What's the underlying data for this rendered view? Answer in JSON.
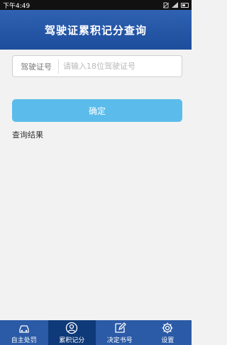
{
  "status_bar": {
    "time": "下午4:49"
  },
  "header": {
    "title": "驾驶证累积记分查询"
  },
  "form": {
    "license_label": "驾驶证号",
    "license_placeholder": "请输入18位驾驶证号",
    "license_value": "",
    "confirm_label": "确定"
  },
  "result": {
    "label": "查询结果"
  },
  "tabs": [
    {
      "label": "自主处罚",
      "icon": "car-icon",
      "active": false
    },
    {
      "label": "累积记分",
      "icon": "user-icon",
      "active": true
    },
    {
      "label": "决定书号",
      "icon": "edit-icon",
      "active": false
    },
    {
      "label": "设置",
      "icon": "gear-icon",
      "active": false
    }
  ],
  "colors": {
    "header": "#2257a8",
    "accent_button": "#5bbcec",
    "tab_bar": "#2b5aa6",
    "tab_active": "#0f3a7a"
  }
}
